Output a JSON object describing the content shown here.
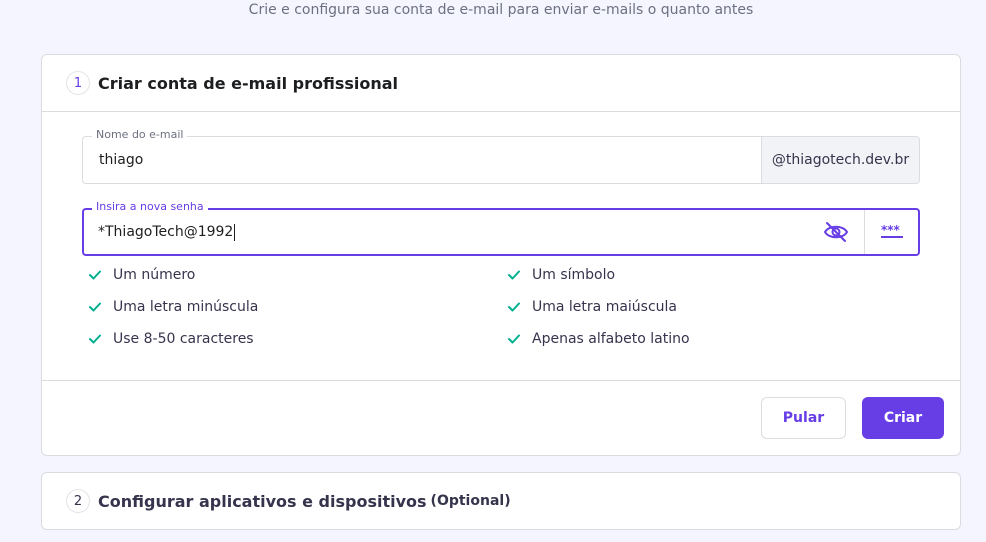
{
  "page": {
    "subtitle": "Crie e configura sua conta de e-mail para enviar e-mails o quanto antes"
  },
  "step1": {
    "number": "1",
    "title": "Criar conta de e-mail profissional",
    "email_field": {
      "label": "Nome do e-mail",
      "value": "thiago",
      "domain_suffix": "@thiagotech.dev.br"
    },
    "password_field": {
      "label": "Insira a nova senha",
      "value": "*ThiagoTech@1992",
      "toggle_icon": "eye-off-icon",
      "generate_icon": "password-dots-icon"
    },
    "requirements": [
      {
        "label": "Um número",
        "met": true
      },
      {
        "label": "Um símbolo",
        "met": true
      },
      {
        "label": "Uma letra minúscula",
        "met": true
      },
      {
        "label": "Uma letra maiúscula",
        "met": true
      },
      {
        "label": "Use 8-50 caracteres",
        "met": true
      },
      {
        "label": "Apenas alfabeto latino",
        "met": true
      }
    ],
    "buttons": {
      "skip": "Pular",
      "create": "Criar"
    }
  },
  "step2": {
    "number": "2",
    "title": "Configurar aplicativos e dispositivos",
    "optional": "(Optional)"
  },
  "colors": {
    "accent": "#673de6",
    "check": "#00b090",
    "background": "#f4f5ff"
  }
}
